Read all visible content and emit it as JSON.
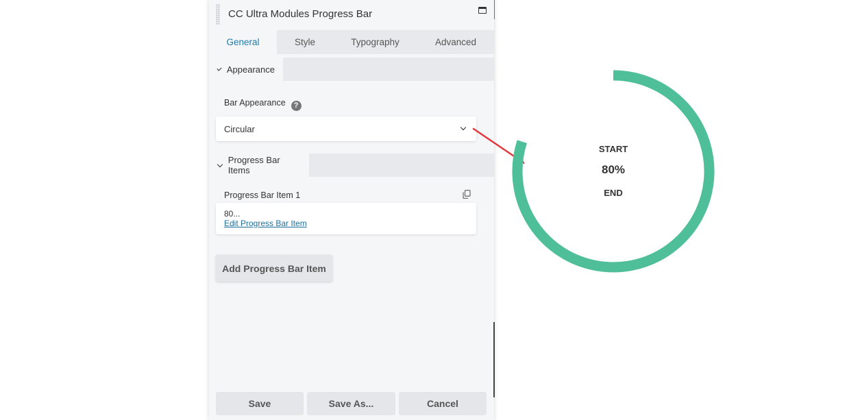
{
  "panel": {
    "title": "CC Ultra Modules Progress Bar",
    "accent_color": "#d8463f"
  },
  "tabs": [
    {
      "label": "General",
      "active": true
    },
    {
      "label": "Style",
      "active": false
    },
    {
      "label": "Typography",
      "active": false
    },
    {
      "label": "Advanced",
      "active": false
    }
  ],
  "appearance": {
    "section_label": "Appearance",
    "bar_appearance_label": "Bar Appearance",
    "help_glyph": "?",
    "selected": "Circular"
  },
  "items": {
    "section_label": "Progress Bar Items",
    "item_title": "Progress Bar Item 1",
    "item_preview": "80...",
    "edit_link": "Edit Progress Bar Item",
    "add_button": "Add Progress Bar Item"
  },
  "footer": {
    "save": "Save",
    "save_as": "Save As...",
    "cancel": "Cancel"
  },
  "preview": {
    "start_label": "START",
    "value_label": "80%",
    "end_label": "END",
    "progress": 0.8,
    "ring_color": "#4fbf99",
    "arrow_color": "#e0383c"
  }
}
